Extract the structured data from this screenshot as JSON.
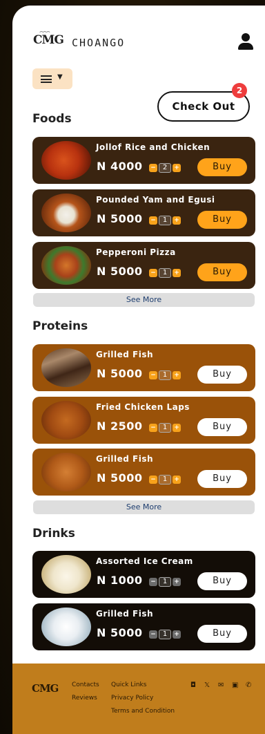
{
  "header": {
    "logo": "CMG",
    "logo_crown": "⌢⌢⌢",
    "brand": "CHOANGO"
  },
  "cart": {
    "checkout_label": "Check Out",
    "count": "2"
  },
  "icons": {
    "menu": "hamburger-icon",
    "dropdown": "chevron-down-icon",
    "user": "user-icon"
  },
  "colors": {
    "accent": "#ffa31a",
    "foods_card": "#3a2410",
    "proteins_card": "#9a5209",
    "drinks_card": "#130d07",
    "footer": "#c07d1c",
    "badge": "#ee3d3d"
  },
  "sections": [
    {
      "title": "Foods",
      "see_more": "See More",
      "items": [
        {
          "name": "Jollof Rice and Chicken",
          "price": "N 4000",
          "qty": "2",
          "buy": "Buy"
        },
        {
          "name": "Pounded Yam and Egusi",
          "price": "N 5000",
          "qty": "1",
          "buy": "Buy"
        },
        {
          "name": "Pepperoni Pizza",
          "price": "N 5000",
          "qty": "1",
          "buy": "Buy"
        }
      ]
    },
    {
      "title": "Proteins",
      "see_more": "See More",
      "items": [
        {
          "name": "Grilled Fish",
          "price": "N 5000",
          "qty": "1",
          "buy": "Buy"
        },
        {
          "name": "Fried Chicken Laps",
          "price": "N 2500",
          "qty": "1",
          "buy": "Buy"
        },
        {
          "name": "Grilled Fish",
          "price": "N 5000",
          "qty": "1",
          "buy": "Buy"
        }
      ]
    },
    {
      "title": "Drinks",
      "items": [
        {
          "name": "Assorted Ice Cream",
          "price": "N 1000",
          "qty": "1",
          "buy": "Buy"
        },
        {
          "name": "Grilled Fish",
          "price": "N 5000",
          "qty": "1",
          "buy": "Buy"
        }
      ]
    }
  ],
  "stepper": {
    "minus": "−",
    "plus": "+"
  },
  "footer": {
    "logo": "CMG",
    "links": {
      "contacts": "Contacts",
      "reviews": "Reviews",
      "quick_links": "Quick Links",
      "privacy": "Privacy Policy",
      "terms": "Terms and Condition"
    },
    "socials": [
      "instagram-icon",
      "x-icon",
      "email-icon",
      "linkedin-icon",
      "phone-icon"
    ]
  }
}
